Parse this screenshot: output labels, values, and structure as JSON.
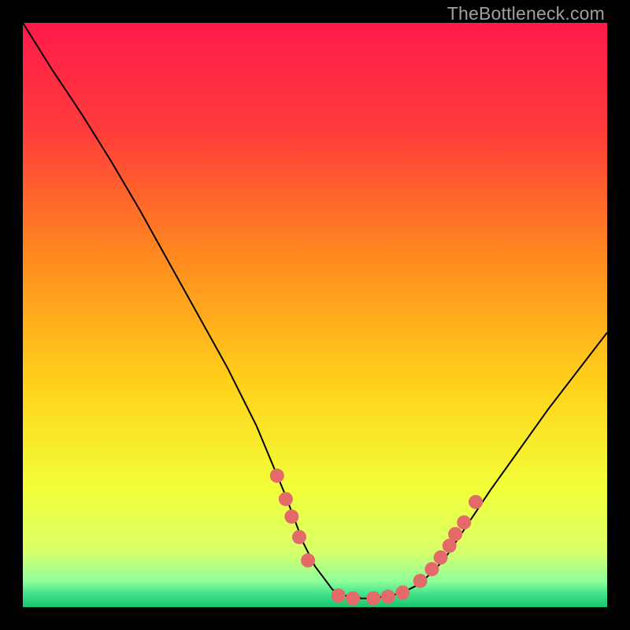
{
  "watermark": "TheBottleneck.com",
  "chart_data": {
    "type": "line",
    "title": "",
    "xlabel": "",
    "ylabel": "",
    "xlim": [
      0,
      100
    ],
    "ylim": [
      0,
      100
    ],
    "background_gradient": {
      "stops": [
        {
          "offset": 0.0,
          "color": "#ff1a4b"
        },
        {
          "offset": 0.18,
          "color": "#ff3b3c"
        },
        {
          "offset": 0.4,
          "color": "#ff8a1f"
        },
        {
          "offset": 0.62,
          "color": "#ffd21a"
        },
        {
          "offset": 0.8,
          "color": "#f2ff3a"
        },
        {
          "offset": 0.905,
          "color": "#d8ff6a"
        },
        {
          "offset": 0.955,
          "color": "#8fff9a"
        },
        {
          "offset": 0.978,
          "color": "#40e28a"
        },
        {
          "offset": 1.0,
          "color": "#19c46f"
        }
      ]
    },
    "series": [
      {
        "name": "bottleneck-curve",
        "stroke": "#000000",
        "x": [
          0,
          5,
          10,
          15,
          20,
          25,
          30,
          35,
          40,
          45,
          48,
          50,
          53,
          55,
          58,
          60,
          63,
          65,
          68,
          72,
          76,
          80,
          85,
          90,
          95,
          100
        ],
        "y": [
          100,
          92,
          84.5,
          76.5,
          68,
          59,
          50,
          41,
          31,
          19,
          11,
          7,
          3,
          2,
          1.5,
          1.5,
          2,
          2.5,
          4,
          8,
          14,
          20,
          27,
          34,
          40.5,
          47
        ]
      }
    ],
    "markers": {
      "name": "highlight-dots",
      "color": "#e46a6a",
      "radius_px": 9,
      "points": [
        {
          "x": 43.5,
          "y": 22.5
        },
        {
          "x": 45.0,
          "y": 18.5
        },
        {
          "x": 46.0,
          "y": 15.5
        },
        {
          "x": 47.3,
          "y": 12.0
        },
        {
          "x": 48.8,
          "y": 8.0
        },
        {
          "x": 54.0,
          "y": 2.0
        },
        {
          "x": 56.5,
          "y": 1.5
        },
        {
          "x": 60.0,
          "y": 1.5
        },
        {
          "x": 62.5,
          "y": 1.8
        },
        {
          "x": 65.0,
          "y": 2.5
        },
        {
          "x": 68.0,
          "y": 4.5
        },
        {
          "x": 70.0,
          "y": 6.5
        },
        {
          "x": 71.5,
          "y": 8.5
        },
        {
          "x": 73.0,
          "y": 10.5
        },
        {
          "x": 74.0,
          "y": 12.5
        },
        {
          "x": 75.5,
          "y": 14.5
        },
        {
          "x": 77.5,
          "y": 18.0
        }
      ]
    }
  }
}
